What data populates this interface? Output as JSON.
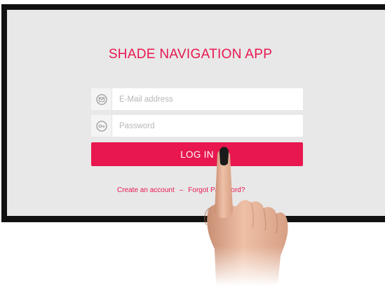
{
  "app": {
    "title": "SHADE NAVIGATION APP"
  },
  "login_form": {
    "email_placeholder": "E-Mail address",
    "email_icon": "envelope-icon",
    "password_placeholder": "Password",
    "password_icon": "key-icon",
    "login_label": "LOG IN"
  },
  "links": {
    "create_account": "Create an account",
    "separator": "–",
    "forgot_password": "Forgot Password?"
  },
  "colors": {
    "accent": "#e8174f",
    "screen_background": "#e8e8e8",
    "frame": "#111111"
  }
}
